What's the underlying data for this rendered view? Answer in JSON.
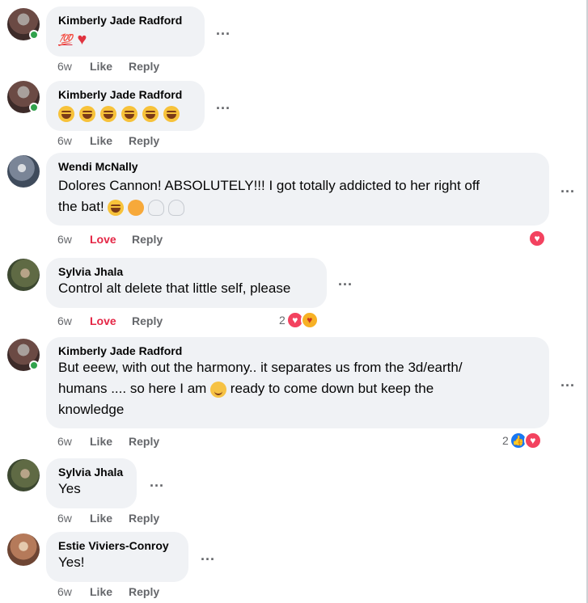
{
  "comments": [
    {
      "author": "Kimberly Jade Radford",
      "emoji_text": "💯",
      "time": "6w",
      "action": "Like",
      "reply": "Reply"
    },
    {
      "author": "Kimberly Jade Radford",
      "time": "6w",
      "action": "Like",
      "reply": "Reply"
    },
    {
      "author": "Wendi McNally",
      "line1": "Dolores Cannon! ABSOLUTELY!!! I got totally addicted to her right off",
      "line2": "the bat!",
      "time": "6w",
      "action": "Love",
      "reply": "Reply"
    },
    {
      "author": "Sylvia Jhala",
      "line1": "Control alt delete that little self, please",
      "time": "6w",
      "action": "Love",
      "reply": "Reply",
      "reaction_count": "2"
    },
    {
      "author": "Kimberly Jade Radford",
      "line1": "But eeew, with out the harmony.. it separates us from the 3d/earth/",
      "line2a": "humans .... so here I am",
      "line2b": "ready to come down but keep the",
      "line3": "knowledge",
      "time": "6w",
      "action": "Like",
      "reply": "Reply",
      "reaction_count": "2"
    },
    {
      "author": "Sylvia Jhala",
      "line1": "Yes",
      "time": "6w",
      "action": "Like",
      "reply": "Reply"
    },
    {
      "author": "Estie Viviers-Conroy",
      "line1": "Yes!",
      "time": "6w",
      "action": "Like",
      "reply": "Reply"
    }
  ],
  "more_label": "...",
  "colors": {
    "bubble": "#f0f2f5",
    "love": "#e42645",
    "like_blue": "#1877f2",
    "muted": "#65676b"
  }
}
